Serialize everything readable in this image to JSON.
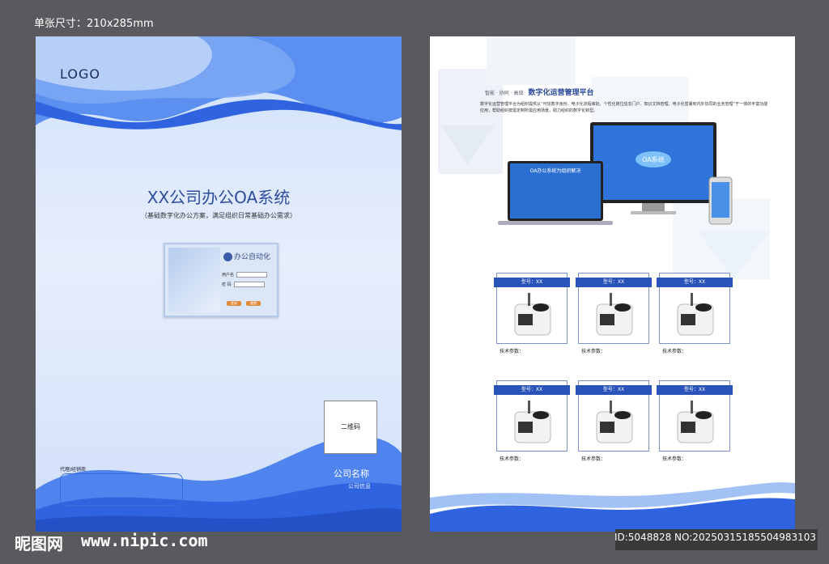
{
  "spec": {
    "label": "单张尺寸：210x285mm"
  },
  "cover": {
    "logo": "LOGO",
    "title": "XX公司办公OA系统",
    "subtitle": "（基础数字化办公方案，满足组织日常基础办公需求）",
    "login": {
      "brand": "办公自动化",
      "username_label": "用户名",
      "password_label": "密  码",
      "btn_login": "登录",
      "btn_reset": "重置"
    },
    "qr_label": "二维码",
    "agent_label": "代理/经销商",
    "company_name": "公司名称",
    "company_info": "公司信息"
  },
  "back": {
    "tagline": "智能 · 协同 · 高效",
    "heading": "数字化运营管理平台",
    "paragraph": "数字化运营管理平台为组织提供从“可信数字身份、电子化流程审批、个性化岗位信息门户、知识文档管理、电子化签署到内外协同的业务管理”于一体的丰富功能应用，帮助组织按需定制所需应用场景，助力组织的数字化转型。",
    "monitor_text": "OA系统",
    "laptop_text": "OA办公系统为组织解决",
    "model_label": "型号：XX",
    "params_label": "技术参数："
  },
  "colors": {
    "brand_blue": "#2953b8",
    "wave_blue": "#2f63e0",
    "light_bg": "#dbe7fb"
  },
  "watermark": {
    "site_cn": "昵图网",
    "site_url": "www.nipic.com",
    "image_id": "ID:5048828 NO:20250315185504983103"
  }
}
